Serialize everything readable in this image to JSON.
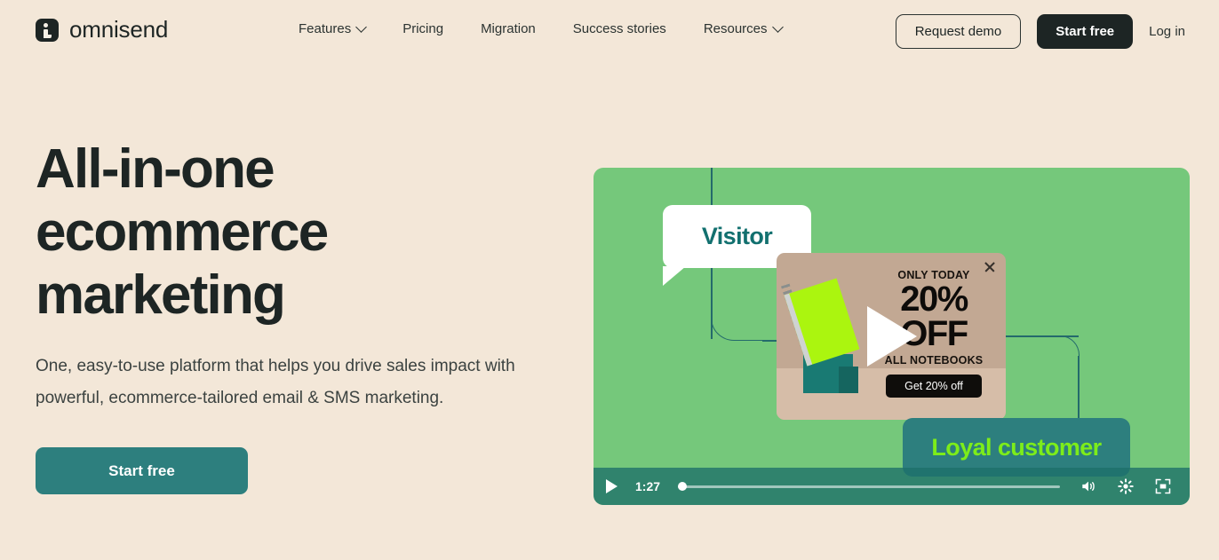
{
  "header": {
    "brand": {
      "name": "omnisend",
      "logo_icon": "omnisend-logo-icon"
    },
    "nav": [
      {
        "label": "Features",
        "has_chevron": true
      },
      {
        "label": "Pricing",
        "has_chevron": false
      },
      {
        "label": "Migration",
        "has_chevron": false
      },
      {
        "label": "Success stories",
        "has_chevron": false
      },
      {
        "label": "Resources",
        "has_chevron": true
      }
    ],
    "request_demo_label": "Request demo",
    "start_free_label": "Start free",
    "login_label": "Log in"
  },
  "hero": {
    "headline": "All-in-one ecommerce marketing",
    "subhead": "One, easy-to-use platform that helps you drive sales impact with powerful, ecommerce-tailored email & SMS marketing.",
    "cta_label": "Start free"
  },
  "video": {
    "visitor_bubble": "Visitor",
    "loyal_bubble": "Loyal customer",
    "popup": {
      "eyebrow": "ONLY TODAY",
      "discount": "20% OFF",
      "discount_line1": "20%",
      "discount_line2": "OFF",
      "subject": "ALL NOTEBOOKS",
      "cta_label": "Get 20% off",
      "close_icon": "close-icon"
    },
    "controls": {
      "play_icon": "play-icon",
      "time": "1:27",
      "progress_percent": 0,
      "volume_icon": "volume-icon",
      "settings_icon": "gear-icon",
      "fullscreen_icon": "fullscreen-icon"
    }
  },
  "colors": {
    "page_background": "#f3e7d8",
    "ink": "#1d2524",
    "teal": "#2d7f7e",
    "video_green": "#75c87b",
    "lime": "#7ded1a",
    "popup_tan": "#c2a893"
  }
}
